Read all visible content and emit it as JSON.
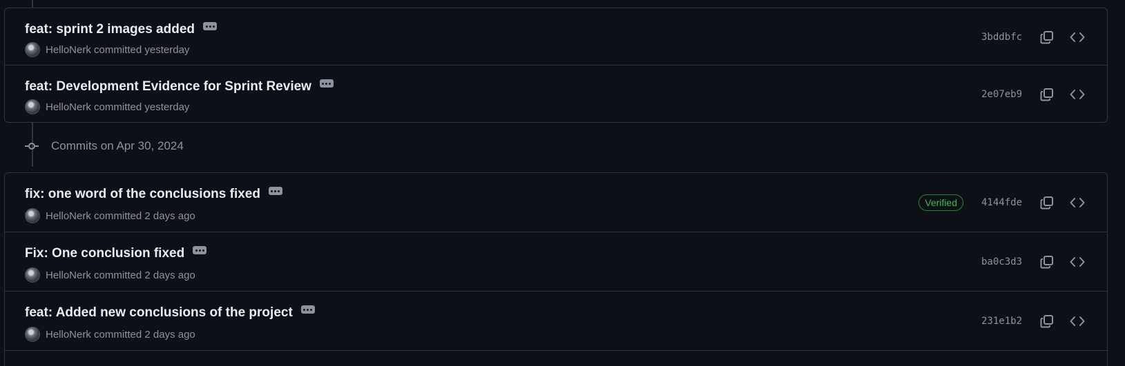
{
  "groups": [
    {
      "commits": [
        {
          "title": "feat: sprint 2 images added",
          "author": "HelloNerk",
          "committed": "committed yesterday",
          "verified": "",
          "sha": "3bddbfc"
        },
        {
          "title": "feat: Development Evidence for Sprint Review",
          "author": "HelloNerk",
          "committed": "committed yesterday",
          "verified": "",
          "sha": "2e07eb9"
        }
      ]
    },
    {
      "header": "Commits on Apr 30, 2024",
      "commits": [
        {
          "title": "fix: one word of the conclusions fixed",
          "author": "HelloNerk",
          "committed": "committed 2 days ago",
          "verified": "Verified",
          "sha": "4144fde"
        },
        {
          "title": "Fix: One conclusion fixed",
          "author": "HelloNerk",
          "committed": "committed 2 days ago",
          "verified": "",
          "sha": "ba0c3d3"
        },
        {
          "title": "feat: Added new conclusions of the project",
          "author": "HelloNerk",
          "committed": "committed 2 days ago",
          "verified": "",
          "sha": "231e1b2"
        }
      ]
    }
  ],
  "icons": {
    "copy": "copy-icon",
    "browse": "code-brackets-icon",
    "commit_node": "git-commit-icon",
    "more": "ellipsis-icon"
  },
  "colors": {
    "background": "#0d1117",
    "border": "#30363d",
    "muted_text": "#8b949e",
    "verified_green": "#3fb950"
  }
}
